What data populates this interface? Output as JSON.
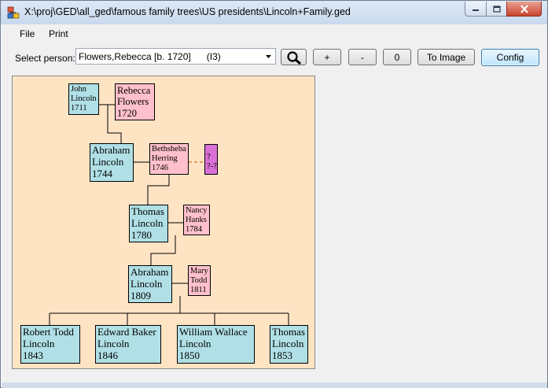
{
  "window": {
    "title": "X:\\proj\\GED\\all_ged\\famous family trees\\US presidents\\Lincoln+Family.ged"
  },
  "menu": {
    "file": "File",
    "print": "Print"
  },
  "toolbar": {
    "select_label": "Select person:",
    "selected_person": "Flowers,Rebecca [b. 1720]      (I3)",
    "plus_label": "+",
    "minus_label": "-",
    "zero_label": "0",
    "to_image_label": "To Image",
    "config_label": "Config"
  },
  "colors": {
    "male": "#b0e0e6",
    "female": "#ffc0cb",
    "unknown": "#da70d6",
    "panel": "#ffe4c4",
    "dashed_link": "#e8823a"
  },
  "tree": {
    "john": {
      "first": "John",
      "last": "Lincoln",
      "year": "1711"
    },
    "rebecca": {
      "first": "Rebecca",
      "last": "Flowers",
      "year": "1720"
    },
    "abraham1": {
      "first": "Abraham",
      "last": "Lincoln",
      "year": "1744"
    },
    "bethsheba": {
      "first": "Bethsheba",
      "last": "Herring",
      "year": "1746"
    },
    "unknown": {
      "first": "?",
      "last": "?-?"
    },
    "thomas1": {
      "first": "Thomas",
      "last": "Lincoln",
      "year": "1780"
    },
    "nancy": {
      "first": "Nancy",
      "last": "Hanks",
      "year": "1784"
    },
    "abraham2": {
      "first": "Abraham",
      "last": "Lincoln",
      "year": "1809"
    },
    "mary": {
      "first": "Mary",
      "last": "Todd",
      "year": "1811"
    },
    "robert": {
      "first": "Robert Todd",
      "last": "Lincoln",
      "year": "1843"
    },
    "edward": {
      "first": "Edward Baker",
      "last": "Lincoln",
      "year": "1846"
    },
    "william": {
      "first": "William Wallace",
      "last": "Lincoln",
      "year": "1850"
    },
    "thomas2": {
      "first": "Thomas",
      "last": "Lincoln",
      "year": "1853"
    }
  }
}
